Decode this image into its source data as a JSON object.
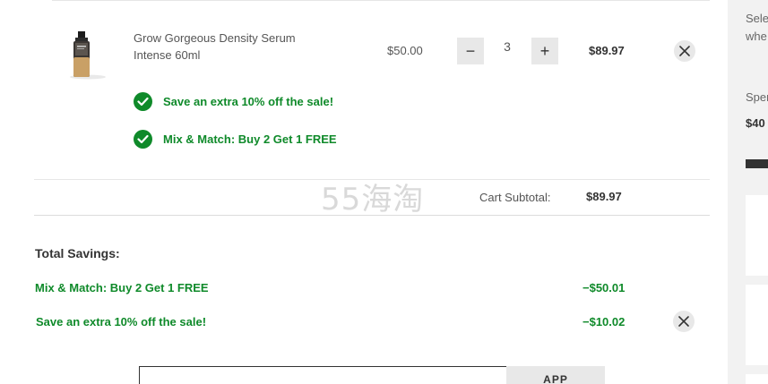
{
  "product": {
    "name": "Grow Gorgeous Density Serum Intense 60ml",
    "unit_price": "$50.00",
    "quantity": "3",
    "line_total": "$89.97",
    "minus_label": "−",
    "plus_label": "+"
  },
  "promos": [
    {
      "label": "Save an extra 10% off the sale!"
    },
    {
      "label": "Mix & Match: Buy 2 Get 1 FREE"
    }
  ],
  "watermark": "55海淘",
  "subtotal": {
    "label": "Cart Subtotal:",
    "value": "$89.97"
  },
  "savings": {
    "title": "Total Savings:",
    "items": [
      {
        "label": "Mix & Match: Buy 2 Get 1 FREE",
        "amount": "−$50.01"
      },
      {
        "label": "Save an extra 10% off the sale!",
        "amount": "−$10.02"
      }
    ]
  },
  "promo_code": {
    "placeholder": "",
    "apply_label": "APP"
  },
  "sidebar": {
    "line1": "Sele",
    "line2": "whe",
    "line3": "Spen",
    "line4": "$40"
  },
  "colors": {
    "green": "#0f8a2a",
    "button_grey": "#e8e8e8",
    "sidebar_bg": "#f2f2f2"
  },
  "icons": {
    "remove": "close-icon",
    "promo_check": "checkmark-icon"
  }
}
